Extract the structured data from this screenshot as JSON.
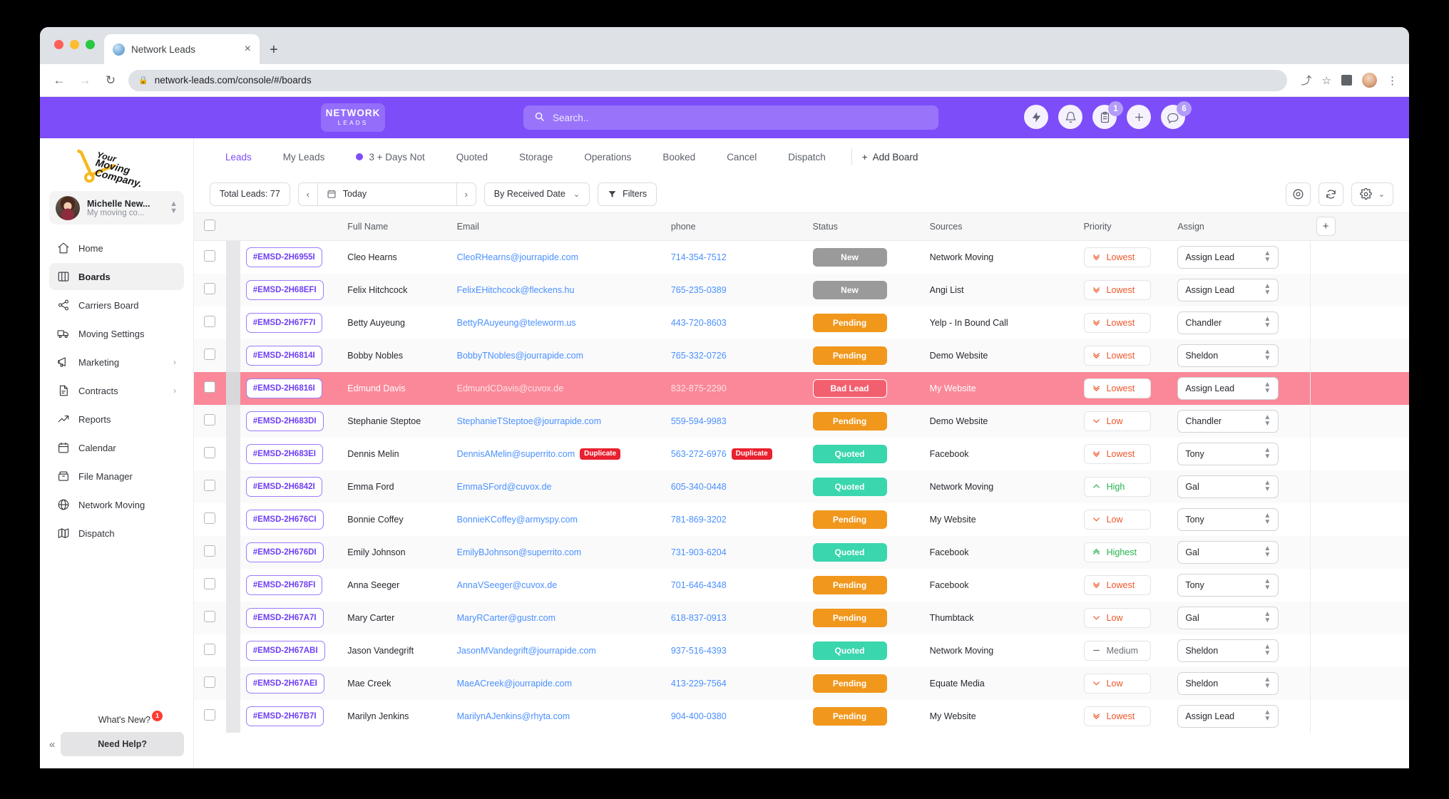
{
  "browser": {
    "tab_title": "Network Leads",
    "tab_close": "×",
    "new_tab": "+",
    "back": "←",
    "forward": "→",
    "reload": "↻",
    "lock": "🔒",
    "url": "network-leads.com/console/#/boards",
    "share": "⤴",
    "star": "☆",
    "menu": "⋮",
    "tab_overflow": "⌄"
  },
  "topbar": {
    "logo_line1": "NETWORK",
    "logo_line2": "LEADS",
    "search_placeholder": "Search..",
    "search_value": "",
    "icons": [
      {
        "name": "flash-icon",
        "badge": ""
      },
      {
        "name": "bell-icon",
        "badge": ""
      },
      {
        "name": "clipboard-icon",
        "badge": "1"
      },
      {
        "name": "plus-icon",
        "badge": ""
      },
      {
        "name": "chat-icon",
        "badge": "6"
      }
    ]
  },
  "sidebar": {
    "brand_line1": "Your",
    "brand_line2": "Moving",
    "brand_line3": "Company.",
    "user": {
      "name": "Michelle New...",
      "company": "My moving co..."
    },
    "items": [
      {
        "label": "Home",
        "icon": "home-icon",
        "active": false,
        "caret": ""
      },
      {
        "label": "Boards",
        "icon": "boards-icon",
        "active": true,
        "caret": ""
      },
      {
        "label": "Carriers Board",
        "icon": "share-icon",
        "active": false,
        "caret": ""
      },
      {
        "label": "Moving Settings",
        "icon": "truck-icon",
        "active": false,
        "caret": ""
      },
      {
        "label": "Marketing",
        "icon": "megaphone-icon",
        "active": false,
        "caret": "›"
      },
      {
        "label": "Contracts",
        "icon": "document-icon",
        "active": false,
        "caret": "›"
      },
      {
        "label": "Reports",
        "icon": "trending-icon",
        "active": false,
        "caret": ""
      },
      {
        "label": "Calendar",
        "icon": "calendar-icon",
        "active": false,
        "caret": ""
      },
      {
        "label": "File Manager",
        "icon": "archive-icon",
        "active": false,
        "caret": ""
      },
      {
        "label": "Network Moving",
        "icon": "globe-icon",
        "active": false,
        "caret": ""
      },
      {
        "label": "Dispatch",
        "icon": "map-icon",
        "active": false,
        "caret": ""
      }
    ],
    "whats_new": "What's New?",
    "whats_new_badge": "1",
    "collapse": "«",
    "need_help": "Need Help?"
  },
  "board_tabs": [
    {
      "label": "Leads",
      "active": true,
      "dot": false
    },
    {
      "label": "My Leads",
      "active": false,
      "dot": false
    },
    {
      "label": "3 + Days Not",
      "active": false,
      "dot": true
    },
    {
      "label": "Quoted",
      "active": false,
      "dot": false
    },
    {
      "label": "Storage",
      "active": false,
      "dot": false
    },
    {
      "label": "Operations",
      "active": false,
      "dot": false
    },
    {
      "label": "Booked",
      "active": false,
      "dot": false
    },
    {
      "label": "Cancel",
      "active": false,
      "dot": false
    },
    {
      "label": "Dispatch",
      "active": false,
      "dot": false
    }
  ],
  "add_board": "Add Board",
  "add_board_plus": "+",
  "toolbar": {
    "total_leads": "Total Leads: 77",
    "prev": "‹",
    "next": "›",
    "date_value": "Today",
    "sort_label": "By Received Date",
    "sort_caret": "⌄",
    "filters_label": "Filters",
    "target_icon": "target-icon",
    "sync_icon": "sync-icon",
    "gear_icon": "gear-icon",
    "gear_caret": "⌄"
  },
  "table": {
    "columns": [
      "",
      "",
      "",
      "Full Name",
      "Email",
      "phone",
      "Status",
      "Sources",
      "Priority",
      "Assign",
      ""
    ],
    "header_full_name": "Full Name",
    "header_email": "Email",
    "header_phone": "phone",
    "header_status": "Status",
    "header_sources": "Sources",
    "header_priority": "Priority",
    "header_assign": "Assign",
    "add_column": "+",
    "rows": [
      {
        "id": "#EMSD-2H6955I",
        "name": "Cleo Hearns",
        "email": "CleoRHearns@jourrapide.com",
        "email_dup": "",
        "phone": "714-354-7512",
        "phone_dup": "",
        "status": "New",
        "status_kind": "new",
        "source": "Network Moving",
        "priority": "Lowest",
        "priority_kind": "lowest",
        "assign": "Assign Lead",
        "bad": false
      },
      {
        "id": "#EMSD-2H68EFI",
        "name": "Felix Hitchcock",
        "email": "FelixEHitchcock@fleckens.hu",
        "email_dup": "",
        "phone": "765-235-0389",
        "phone_dup": "",
        "status": "New",
        "status_kind": "new",
        "source": "Angi List",
        "priority": "Lowest",
        "priority_kind": "lowest",
        "assign": "Assign Lead",
        "bad": false
      },
      {
        "id": "#EMSD-2H67F7I",
        "name": "Betty Auyeung",
        "email": "BettyRAuyeung@teleworm.us",
        "email_dup": "",
        "phone": "443-720-8603",
        "phone_dup": "",
        "status": "Pending",
        "status_kind": "pending",
        "source": "Yelp - In Bound Call",
        "priority": "Lowest",
        "priority_kind": "lowest",
        "assign": "Chandler",
        "bad": false
      },
      {
        "id": "#EMSD-2H6814I",
        "name": "Bobby Nobles",
        "email": "BobbyTNobles@jourrapide.com",
        "email_dup": "",
        "phone": "765-332-0726",
        "phone_dup": "",
        "status": "Pending",
        "status_kind": "pending",
        "source": "Demo Website",
        "priority": "Lowest",
        "priority_kind": "lowest",
        "assign": "Sheldon",
        "bad": false
      },
      {
        "id": "#EMSD-2H6816I",
        "name": "Edmund Davis",
        "email": "EdmundCDavis@cuvox.de",
        "email_dup": "",
        "phone": "832-875-2290",
        "phone_dup": "",
        "status": "Bad Lead",
        "status_kind": "bad",
        "source": "My Website",
        "priority": "Lowest",
        "priority_kind": "lowest",
        "assign": "Assign Lead",
        "bad": true
      },
      {
        "id": "#EMSD-2H683DI",
        "name": "Stephanie Steptoe",
        "email": "StephanieTSteptoe@jourrapide.com",
        "email_dup": "",
        "phone": "559-594-9983",
        "phone_dup": "",
        "status": "Pending",
        "status_kind": "pending",
        "source": "Demo Website",
        "priority": "Low",
        "priority_kind": "low",
        "assign": "Chandler",
        "bad": false
      },
      {
        "id": "#EMSD-2H683EI",
        "name": "Dennis Melin",
        "email": "DennisAMelin@superrito.com",
        "email_dup": "Duplicate",
        "phone": "563-272-6976",
        "phone_dup": "Duplicate",
        "status": "Quoted",
        "status_kind": "quoted",
        "source": "Facebook",
        "priority": "Lowest",
        "priority_kind": "lowest",
        "assign": "Tony",
        "bad": false
      },
      {
        "id": "#EMSD-2H6842I",
        "name": "Emma Ford",
        "email": "EmmaSFord@cuvox.de",
        "email_dup": "",
        "phone": "605-340-0448",
        "phone_dup": "",
        "status": "Quoted",
        "status_kind": "quoted",
        "source": "Network Moving",
        "priority": "High",
        "priority_kind": "high",
        "assign": "Gal",
        "bad": false
      },
      {
        "id": "#EMSD-2H676CI",
        "name": "Bonnie Coffey",
        "email": "BonnieKCoffey@armyspy.com",
        "email_dup": "",
        "phone": "781-869-3202",
        "phone_dup": "",
        "status": "Pending",
        "status_kind": "pending",
        "source": "My Website",
        "priority": "Low",
        "priority_kind": "low",
        "assign": "Tony",
        "bad": false
      },
      {
        "id": "#EMSD-2H676DI",
        "name": "Emily Johnson",
        "email": "EmilyBJohnson@superrito.com",
        "email_dup": "",
        "phone": "731-903-6204",
        "phone_dup": "",
        "status": "Quoted",
        "status_kind": "quoted",
        "source": "Facebook",
        "priority": "Highest",
        "priority_kind": "highest",
        "assign": "Gal",
        "bad": false
      },
      {
        "id": "#EMSD-2H678FI",
        "name": "Anna Seeger",
        "email": "AnnaVSeeger@cuvox.de",
        "email_dup": "",
        "phone": "701-646-4348",
        "phone_dup": "",
        "status": "Pending",
        "status_kind": "pending",
        "source": "Facebook",
        "priority": "Lowest",
        "priority_kind": "lowest",
        "assign": "Tony",
        "bad": false
      },
      {
        "id": "#EMSD-2H67A7I",
        "name": "Mary Carter",
        "email": "MaryRCarter@gustr.com",
        "email_dup": "",
        "phone": "618-837-0913",
        "phone_dup": "",
        "status": "Pending",
        "status_kind": "pending",
        "source": "Thumbtack",
        "priority": "Low",
        "priority_kind": "low",
        "assign": "Gal",
        "bad": false
      },
      {
        "id": "#EMSD-2H67ABI",
        "name": "Jason Vandegrift",
        "email": "JasonMVandegrift@jourrapide.com",
        "email_dup": "",
        "phone": "937-516-4393",
        "phone_dup": "",
        "status": "Quoted",
        "status_kind": "quoted",
        "source": "Network Moving",
        "priority": "Medium",
        "priority_kind": "medium",
        "assign": "Sheldon",
        "bad": false
      },
      {
        "id": "#EMSD-2H67AEI",
        "name": "Mae Creek",
        "email": "MaeACreek@jourrapide.com",
        "email_dup": "",
        "phone": "413-229-7564",
        "phone_dup": "",
        "status": "Pending",
        "status_kind": "pending",
        "source": "Equate Media",
        "priority": "Low",
        "priority_kind": "low",
        "assign": "Sheldon",
        "bad": false
      },
      {
        "id": "#EMSD-2H67B7I",
        "name": "Marilyn Jenkins",
        "email": "MarilynAJenkins@rhyta.com",
        "email_dup": "",
        "phone": "904-400-0380",
        "phone_dup": "",
        "status": "Pending",
        "status_kind": "pending",
        "source": "My Website",
        "priority": "Lowest",
        "priority_kind": "lowest",
        "assign": "Assign Lead",
        "bad": false
      }
    ]
  },
  "colors": {
    "brand_purple": "#7d4dfa",
    "status_new": "#9a9a9a",
    "status_pending": "#f0971c",
    "status_quoted": "#3ad6ad",
    "status_bad": "#f2606f",
    "bad_row": "#fa8898",
    "duplicate": "#e8212f",
    "priority_low": "#f0562a",
    "priority_high": "#24b24c",
    "link": "#4a90ff"
  }
}
